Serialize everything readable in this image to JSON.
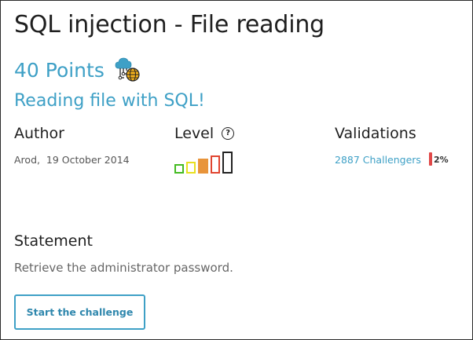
{
  "challenge": {
    "title": "SQL injection - File reading",
    "points": "40 Points",
    "category_icon": "cloud-globe-network-icon",
    "subtitle": "Reading file with SQL!"
  },
  "author": {
    "heading": "Author",
    "info": "Arod,  19 October 2014"
  },
  "level": {
    "heading": "Level",
    "help_icon": "question-circle-icon",
    "value": 3,
    "max": 5,
    "colors": [
      "#44bb22",
      "#e8e020",
      "#e8943a",
      "#e04530",
      "#222222"
    ]
  },
  "validations": {
    "heading": "Validations",
    "challengers": "2887 Challengers",
    "percent": "2%",
    "bar_color": "#e04848"
  },
  "statement": {
    "heading": "Statement",
    "text": "Retrieve the administrator password."
  },
  "actions": {
    "start_label": "Start the challenge"
  },
  "colors": {
    "accent": "#3ea0c6"
  }
}
